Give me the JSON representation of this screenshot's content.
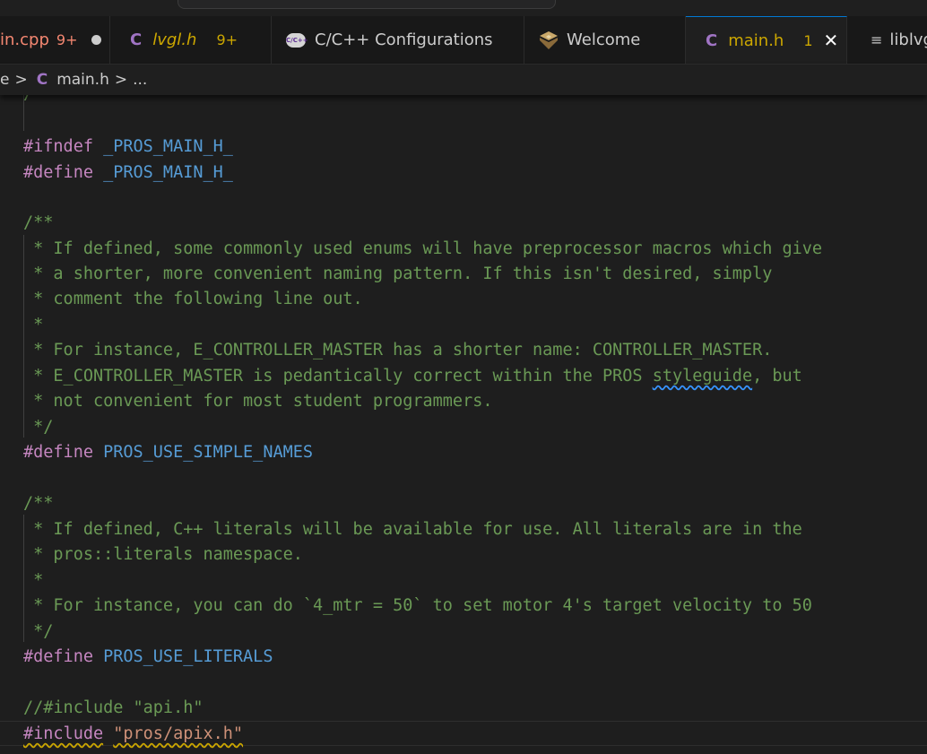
{
  "tabs": [
    {
      "label": "in.cpp",
      "count": "9+",
      "color": "#f48771",
      "modified": true
    },
    {
      "label": "lvgl.h",
      "count": "9+",
      "icon": "C",
      "color": "#cca700"
    },
    {
      "label": "C/C++ Configurations",
      "icon_text": "C/C++"
    },
    {
      "label": "Welcome"
    },
    {
      "label": "main.h",
      "count": "1",
      "icon": "C",
      "color": "#cca700",
      "active": true
    },
    {
      "label": "liblvg"
    }
  ],
  "breadcrumb": {
    "fragment": "e",
    "sep": ">",
    "icon": "C",
    "file": "main.h",
    "more": "..."
  },
  "code": {
    "l0": "/**",
    "l1_kw": "#ifndef",
    "l1_mac": "_PROS_MAIN_H_",
    "l2_kw": "#define",
    "l2_mac": "_PROS_MAIN_H_",
    "c1": [
      "/**",
      " * If defined, some commonly used enums will have preprocessor macros which give",
      " * a shorter, more convenient naming pattern. If this isn't desired, simply",
      " * comment the following line out.",
      " *",
      " * For instance, E_CONTROLLER_MASTER has a shorter name: CONTROLLER_MASTER."
    ],
    "c1_l6_pre": " * E_CONTROLLER_MASTER is pedantically correct within the PROS ",
    "c1_l6_word": "styleguide",
    "c1_l6_post": ", but",
    "c1_l7": " * not convenient for most student programmers.",
    "c1_end": " */",
    "d1_kw": "#define",
    "d1_mac": "PROS_USE_SIMPLE_NAMES",
    "c2": [
      "/**",
      " * If defined, C++ literals will be available for use. All literals are in the",
      " * pros::literals namespace.",
      " *",
      " * For instance, you can do `4_mtr = 50` to set motor 4's target velocity to 50",
      " */"
    ],
    "d2_kw": "#define",
    "d2_mac": "PROS_USE_LITERALS",
    "inc1": "//#include \"api.h\"",
    "inc2_kw": "#include",
    "inc2_str": "\"pros/apix.h\""
  }
}
